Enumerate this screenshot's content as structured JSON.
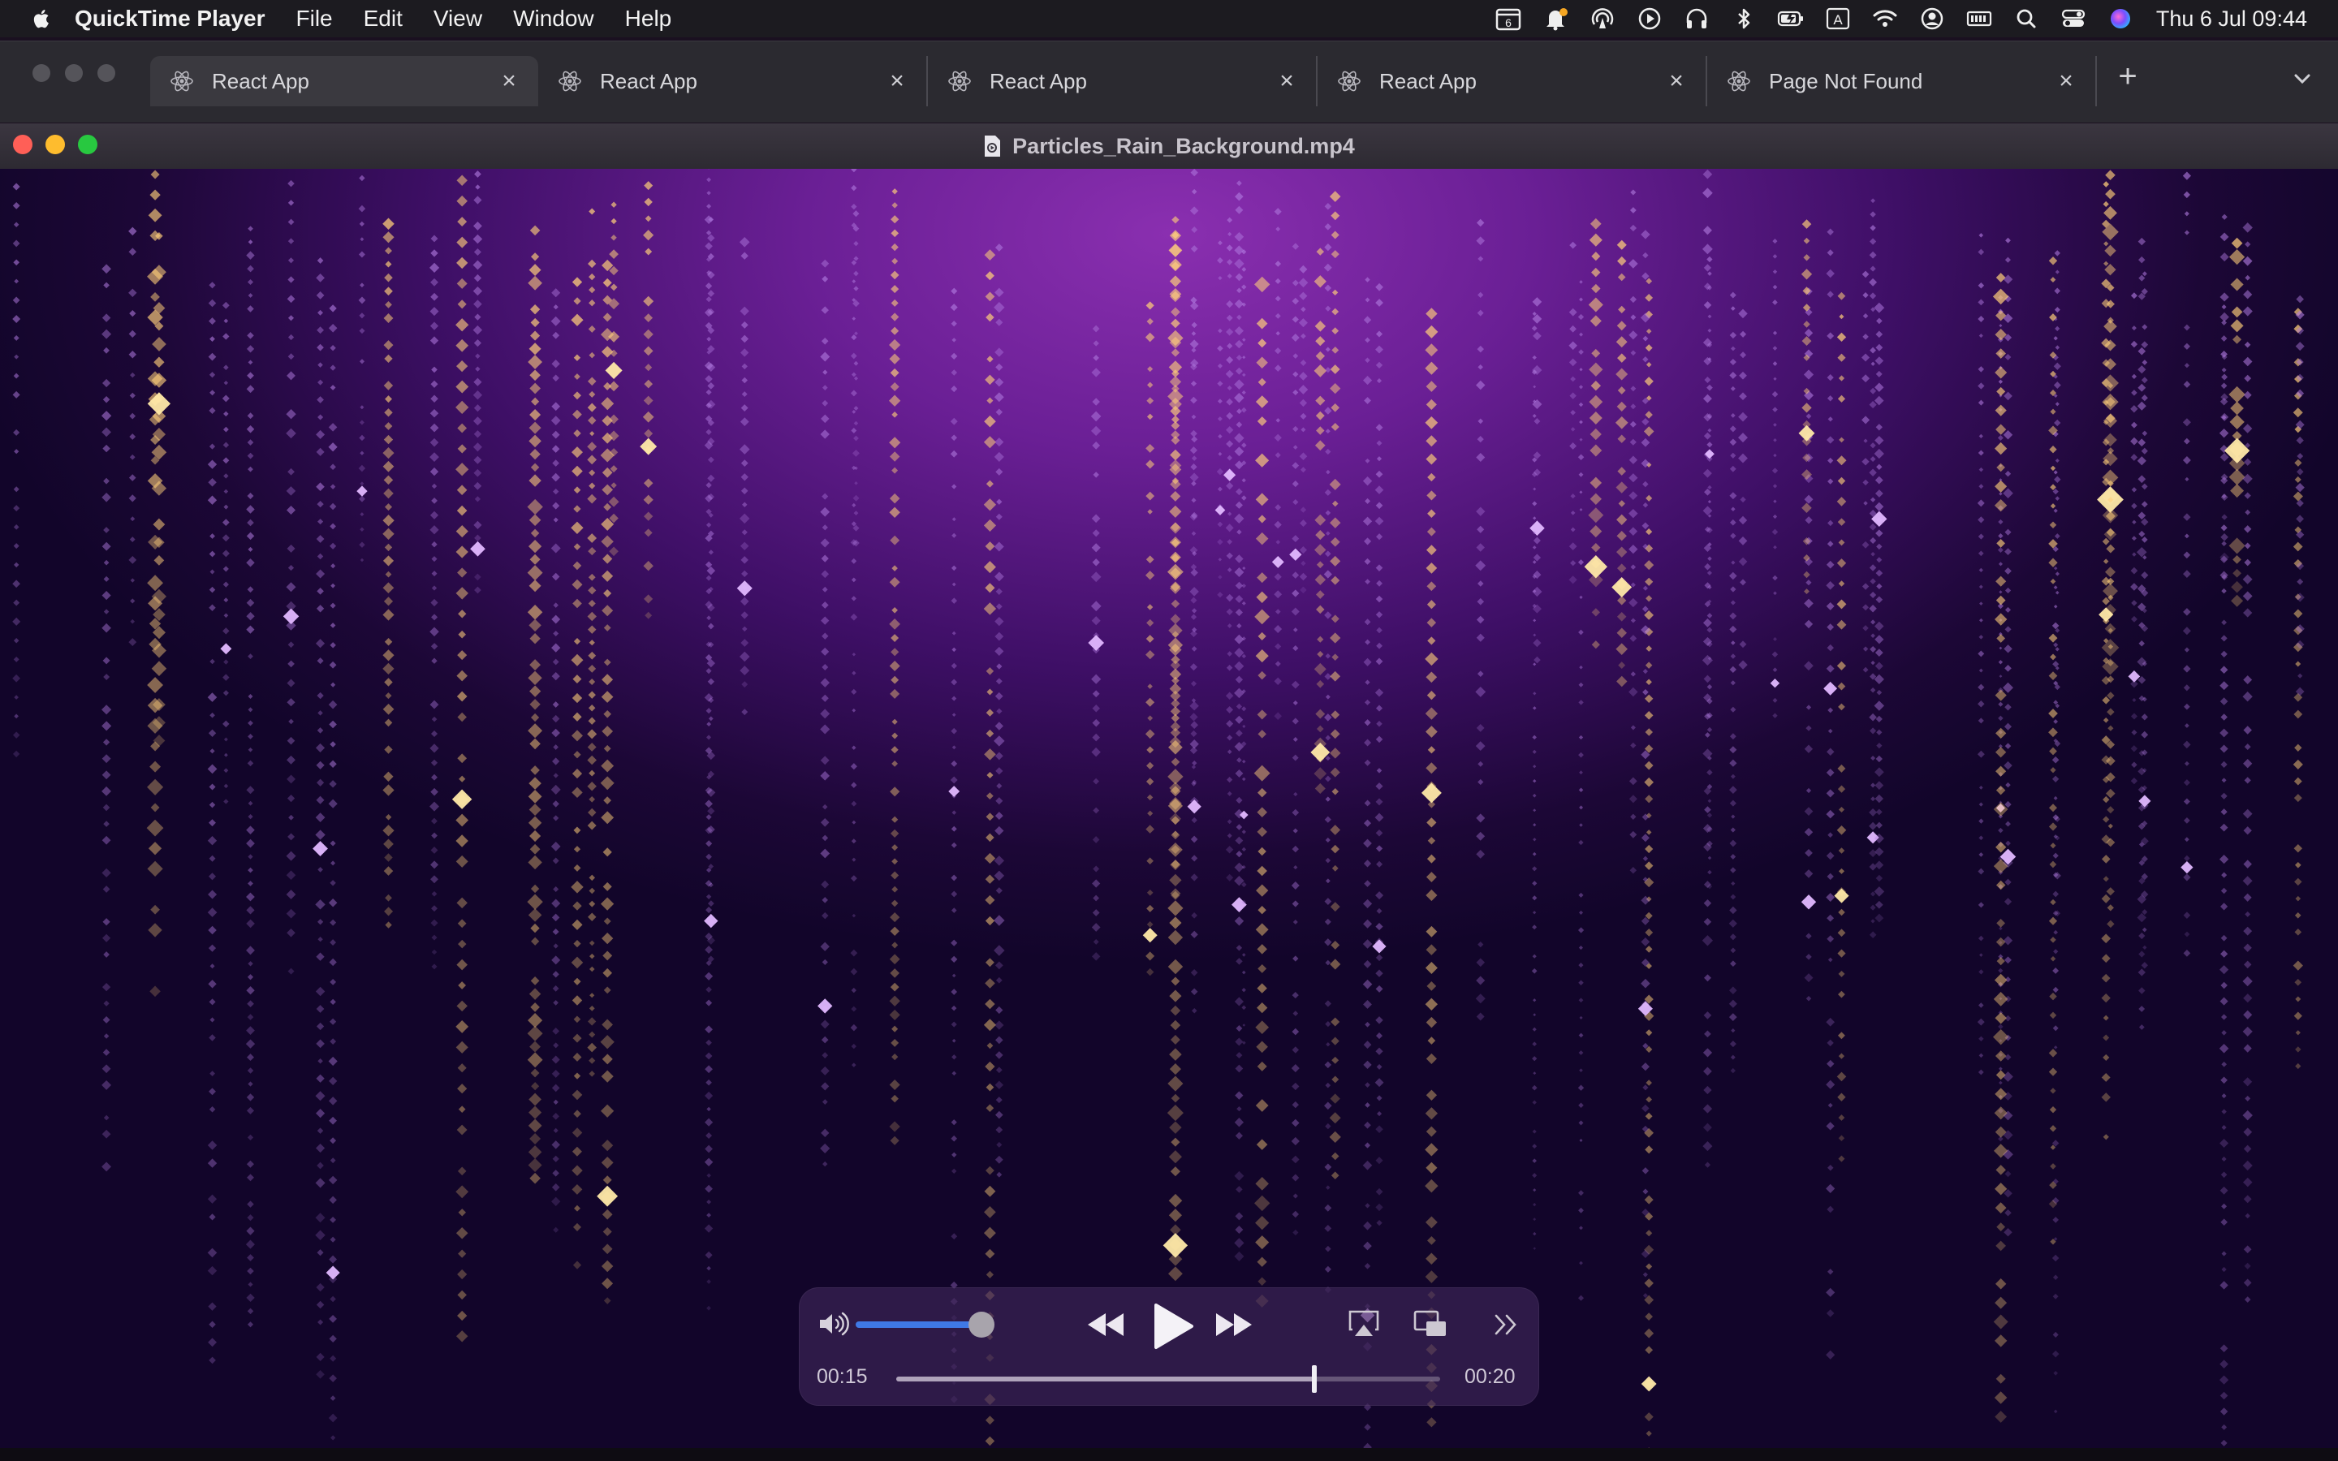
{
  "menubar": {
    "app_name": "QuickTime Player",
    "items": [
      "File",
      "Edit",
      "View",
      "Window",
      "Help"
    ],
    "calendar_day": "6",
    "keyboard_input": "A",
    "clock": "Thu 6 Jul  09:44"
  },
  "browser": {
    "tabs": [
      {
        "label": "React App",
        "favicon": "react-icon"
      },
      {
        "label": "React App",
        "favicon": "react-icon"
      },
      {
        "label": "React App",
        "favicon": "react-icon"
      },
      {
        "label": "React App",
        "favicon": "react-icon"
      },
      {
        "label": "Page Not Found",
        "favicon": "react-icon"
      }
    ],
    "new_tab": "+"
  },
  "window": {
    "title": "Particles_Rain_Background.mp4"
  },
  "player": {
    "current_time": "00:15",
    "total_time": "00:20",
    "progress_fraction": 0.77,
    "volume_fraction": 0.85
  },
  "colors": {
    "accent_blue": "#3f79e6",
    "close": "#ff5f57",
    "minimize": "#febc2e",
    "zoom": "#28c840",
    "particle_gold": "#ffcf7a",
    "particle_violet": "#b07adf"
  }
}
